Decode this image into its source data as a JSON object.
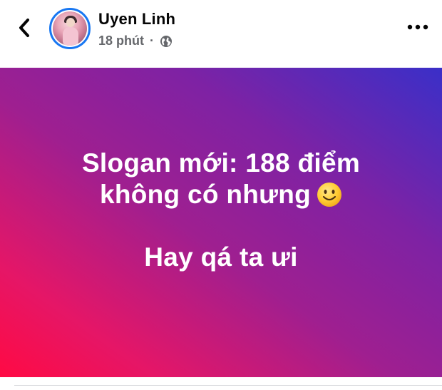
{
  "header": {
    "back_icon": "chevron-left-icon",
    "author_name": "Uyen Linh",
    "time_ago": "18 phút",
    "separator": "·",
    "audience_icon": "globe-icon",
    "more_icon": "more-horizontal-icon"
  },
  "post": {
    "line1": "Slogan mới: 188 điểm",
    "line2": "không có nhưng",
    "emoji_icon": "slightly-smiling-face-icon",
    "line3": "Hay qá ta ưi",
    "background_gradient": [
      "#ff0a44",
      "#9f1f90",
      "#3a2fc8"
    ],
    "text_color": "#ffffff"
  },
  "colors": {
    "accent": "#1877f2",
    "name": "#050505",
    "meta": "#65676b"
  }
}
